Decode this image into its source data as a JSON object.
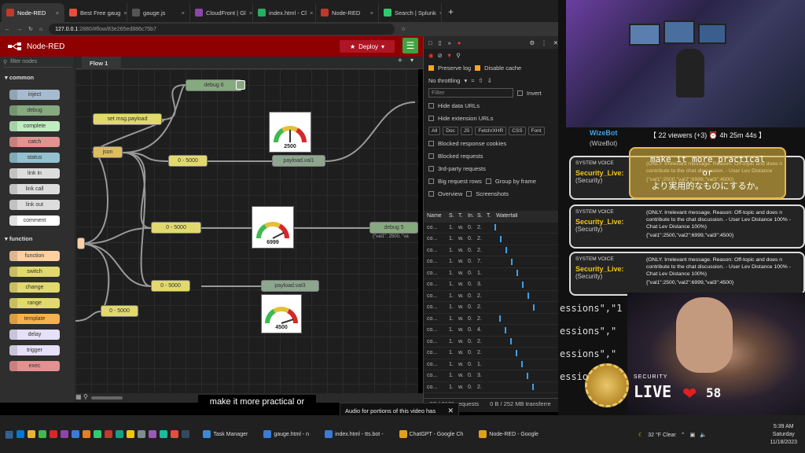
{
  "browser": {
    "tabs": [
      {
        "label": "Node-RED",
        "color": "#c0392b",
        "active": true
      },
      {
        "label": "Best Free gaug",
        "color": "#e74c3c"
      },
      {
        "label": "gauge.js",
        "color": "#555555"
      },
      {
        "label": "CloudFront | Gl",
        "color": "#8e44ad"
      },
      {
        "label": "index.html - Cl",
        "color": "#27ae60"
      },
      {
        "label": "Node-RED",
        "color": "#c0392b"
      },
      {
        "label": "Search | Splunk",
        "color": "#2ecc71"
      }
    ],
    "url_host": "127.0.0.1",
    "url_path": ":2880/#flow/83e265ed886c75b7"
  },
  "nodered": {
    "title": "Node-RED",
    "deploy_label": "Deploy",
    "filter_placeholder": "filter nodes",
    "flow_tab": "Flow 1",
    "categories": {
      "common": "common",
      "function": "function"
    },
    "palette_common": [
      {
        "label": "inject",
        "color": "#a6bbcf"
      },
      {
        "label": "debug",
        "color": "#87a980"
      },
      {
        "label": "complete",
        "color": "#c0edc0"
      },
      {
        "label": "catch",
        "color": "#e49191"
      },
      {
        "label": "status",
        "color": "#94c1d0"
      },
      {
        "label": "link in",
        "color": "#dddddd"
      },
      {
        "label": "link call",
        "color": "#dddddd"
      },
      {
        "label": "link out",
        "color": "#dddddd"
      },
      {
        "label": "comment",
        "color": "#ffffff"
      }
    ],
    "palette_function": [
      {
        "label": "function",
        "color": "#fdd0a2"
      },
      {
        "label": "switch",
        "color": "#e2d96e"
      },
      {
        "label": "change",
        "color": "#e2d96e"
      },
      {
        "label": "range",
        "color": "#e2d96e"
      },
      {
        "label": "template",
        "color": "#f6b24b"
      },
      {
        "label": "delay",
        "color": "#e6e0f8"
      },
      {
        "label": "trigger",
        "color": "#e6e0f8"
      },
      {
        "label": "exec",
        "color": "#e49191"
      }
    ],
    "flow_nodes": {
      "debug6": "debug 6",
      "set_payload": "set msg.payload",
      "json": "json",
      "range1": "0 - 5000",
      "payload_val1": "payload.val1",
      "range2": "0 - 5000",
      "debug5": "debug 5",
      "debug5_status": "{\"val1\": 2500, \"va",
      "range3": "0 - 5000",
      "payload_val3": "payload.val3",
      "range4": "0 - 5000"
    },
    "gauges": [
      {
        "value": "2500",
        "level": 0.5
      },
      {
        "value": "6999",
        "level": 0.85
      },
      {
        "value": "4500",
        "level": 0.9
      }
    ]
  },
  "devtools": {
    "preserve_log": "Preserve log",
    "disable_cache": "Disable cache",
    "throttling": "No throttling",
    "filter_placeholder": "Filter",
    "invert": "Invert",
    "hide_data_urls": "Hide data URLs",
    "hide_ext_urls": "Hide extension URLs",
    "type_chips": [
      "All",
      "Doc",
      "JS",
      "Fetch/XHR",
      "CSS",
      "Font"
    ],
    "blocked_cookies": "Blocked response cookies",
    "blocked_requests": "Blocked requests",
    "third_party": "3rd-party requests",
    "big_rows": "Big request rows",
    "group_frame": "Group by frame",
    "overview": "Overview",
    "screenshots": "Screenshots",
    "columns": [
      "Name",
      "S.",
      "T.",
      "In.",
      "S.",
      "T.",
      "Waterfall"
    ],
    "rows": [
      [
        "co...",
        "1.",
        "w.",
        "0.",
        "2."
      ],
      [
        "co...",
        "1.",
        "w.",
        "0.",
        "2."
      ],
      [
        "co...",
        "1.",
        "w.",
        "0.",
        "2."
      ],
      [
        "co...",
        "1.",
        "w.",
        "0.",
        "7."
      ],
      [
        "co...",
        "1.",
        "w.",
        "0.",
        "1."
      ],
      [
        "co...",
        "1.",
        "w.",
        "0.",
        "3."
      ],
      [
        "co...",
        "1.",
        "w.",
        "0.",
        "2."
      ],
      [
        "co...",
        "1.",
        "w.",
        "0.",
        "2."
      ],
      [
        "co...",
        "1.",
        "w.",
        "0.",
        "2."
      ],
      [
        "co...",
        "1.",
        "w.",
        "0.",
        "4."
      ],
      [
        "co...",
        "1.",
        "w.",
        "0.",
        "2."
      ],
      [
        "co...",
        "1.",
        "w.",
        "0.",
        "2."
      ],
      [
        "co...",
        "1.",
        "w.",
        "0.",
        "1."
      ],
      [
        "co...",
        "1.",
        "w.",
        "0.",
        "3."
      ],
      [
        "co...",
        "1.",
        "w.",
        "0.",
        "2."
      ]
    ],
    "status_requests": "52 / 2171 requests",
    "status_transfer": "0 B / 252 MB transferre"
  },
  "stream": {
    "wizebot_name": "WizeBot",
    "wizebot_sub": "(WizeBot)",
    "viewers": "【 22 viewers (+3) ⏰ 4h 25m 44s 】",
    "translation_line1": "make it more practical",
    "translation_line2": "or",
    "translation_line3": "より実用的なものにするか。",
    "messages": [
      {
        "sv": "SYSTEM VOICE",
        "name": "Security_Live:",
        "sub": "(Security)",
        "body1": "(ONLY. Irrelevant message. Reason: Off-topic and does n",
        "body2": "contribute to the chat discussion. - User Lev Distance",
        "body3": "{\"val1\":2500,\"val2\":6999,\"val3\":4500}"
      },
      {
        "sv": "SYSTEM VOICE",
        "name": "Security_Live:",
        "sub": "(Security)",
        "body1": "(ONLY. Irrelevant message. Reason: Off-topic and does n",
        "body2": "contribute to the chat discussion. - User Lev Distance 100% - Chat Lev Distance 100%)",
        "body3": "{\"val1\":2500,\"val2\":6999,\"val3\":4500}"
      },
      {
        "sv": "SYSTEM VOICE",
        "name": "Security_Live:",
        "sub": "(Security)",
        "body1": "(ONLY. Irrelevant message. Reason: Off-topic and does n",
        "body2": "contribute to the chat discussion. - User Lev Distance 100% - Chat Lev Distance 100%)",
        "body3": "{\"val1\":2500,\"val2\":6999,\"val3\":4500}"
      }
    ],
    "code_lines": [
      "essions\",\"1",
      "essions\",\"",
      "essions\",\"",
      "ession"
    ],
    "logo_text": "SECURITY",
    "live_text": "LIVE",
    "heart_count": "58"
  },
  "caption": "make it more practical or",
  "notice": "Audio for portions of this video has been muted as it appears to contain copyrighted content owned or controlled by a third party.",
  "taskbar": {
    "apps": [
      {
        "label": "Task Manager",
        "color": "#3a8ad6"
      },
      {
        "label": "gauge.html - n",
        "color": "#3a7bd5"
      },
      {
        "label": "index.html - tts.bot -",
        "color": "#3a7bd5"
      },
      {
        "label": "ChatGPT - Google Ch",
        "color": "#e0a020"
      },
      {
        "label": "Node-RED - Google",
        "color": "#e0a020"
      }
    ],
    "weather": "32 °F  Clear",
    "time": "5:39 AM",
    "day": "Saturday",
    "date": "11/18/2023"
  }
}
